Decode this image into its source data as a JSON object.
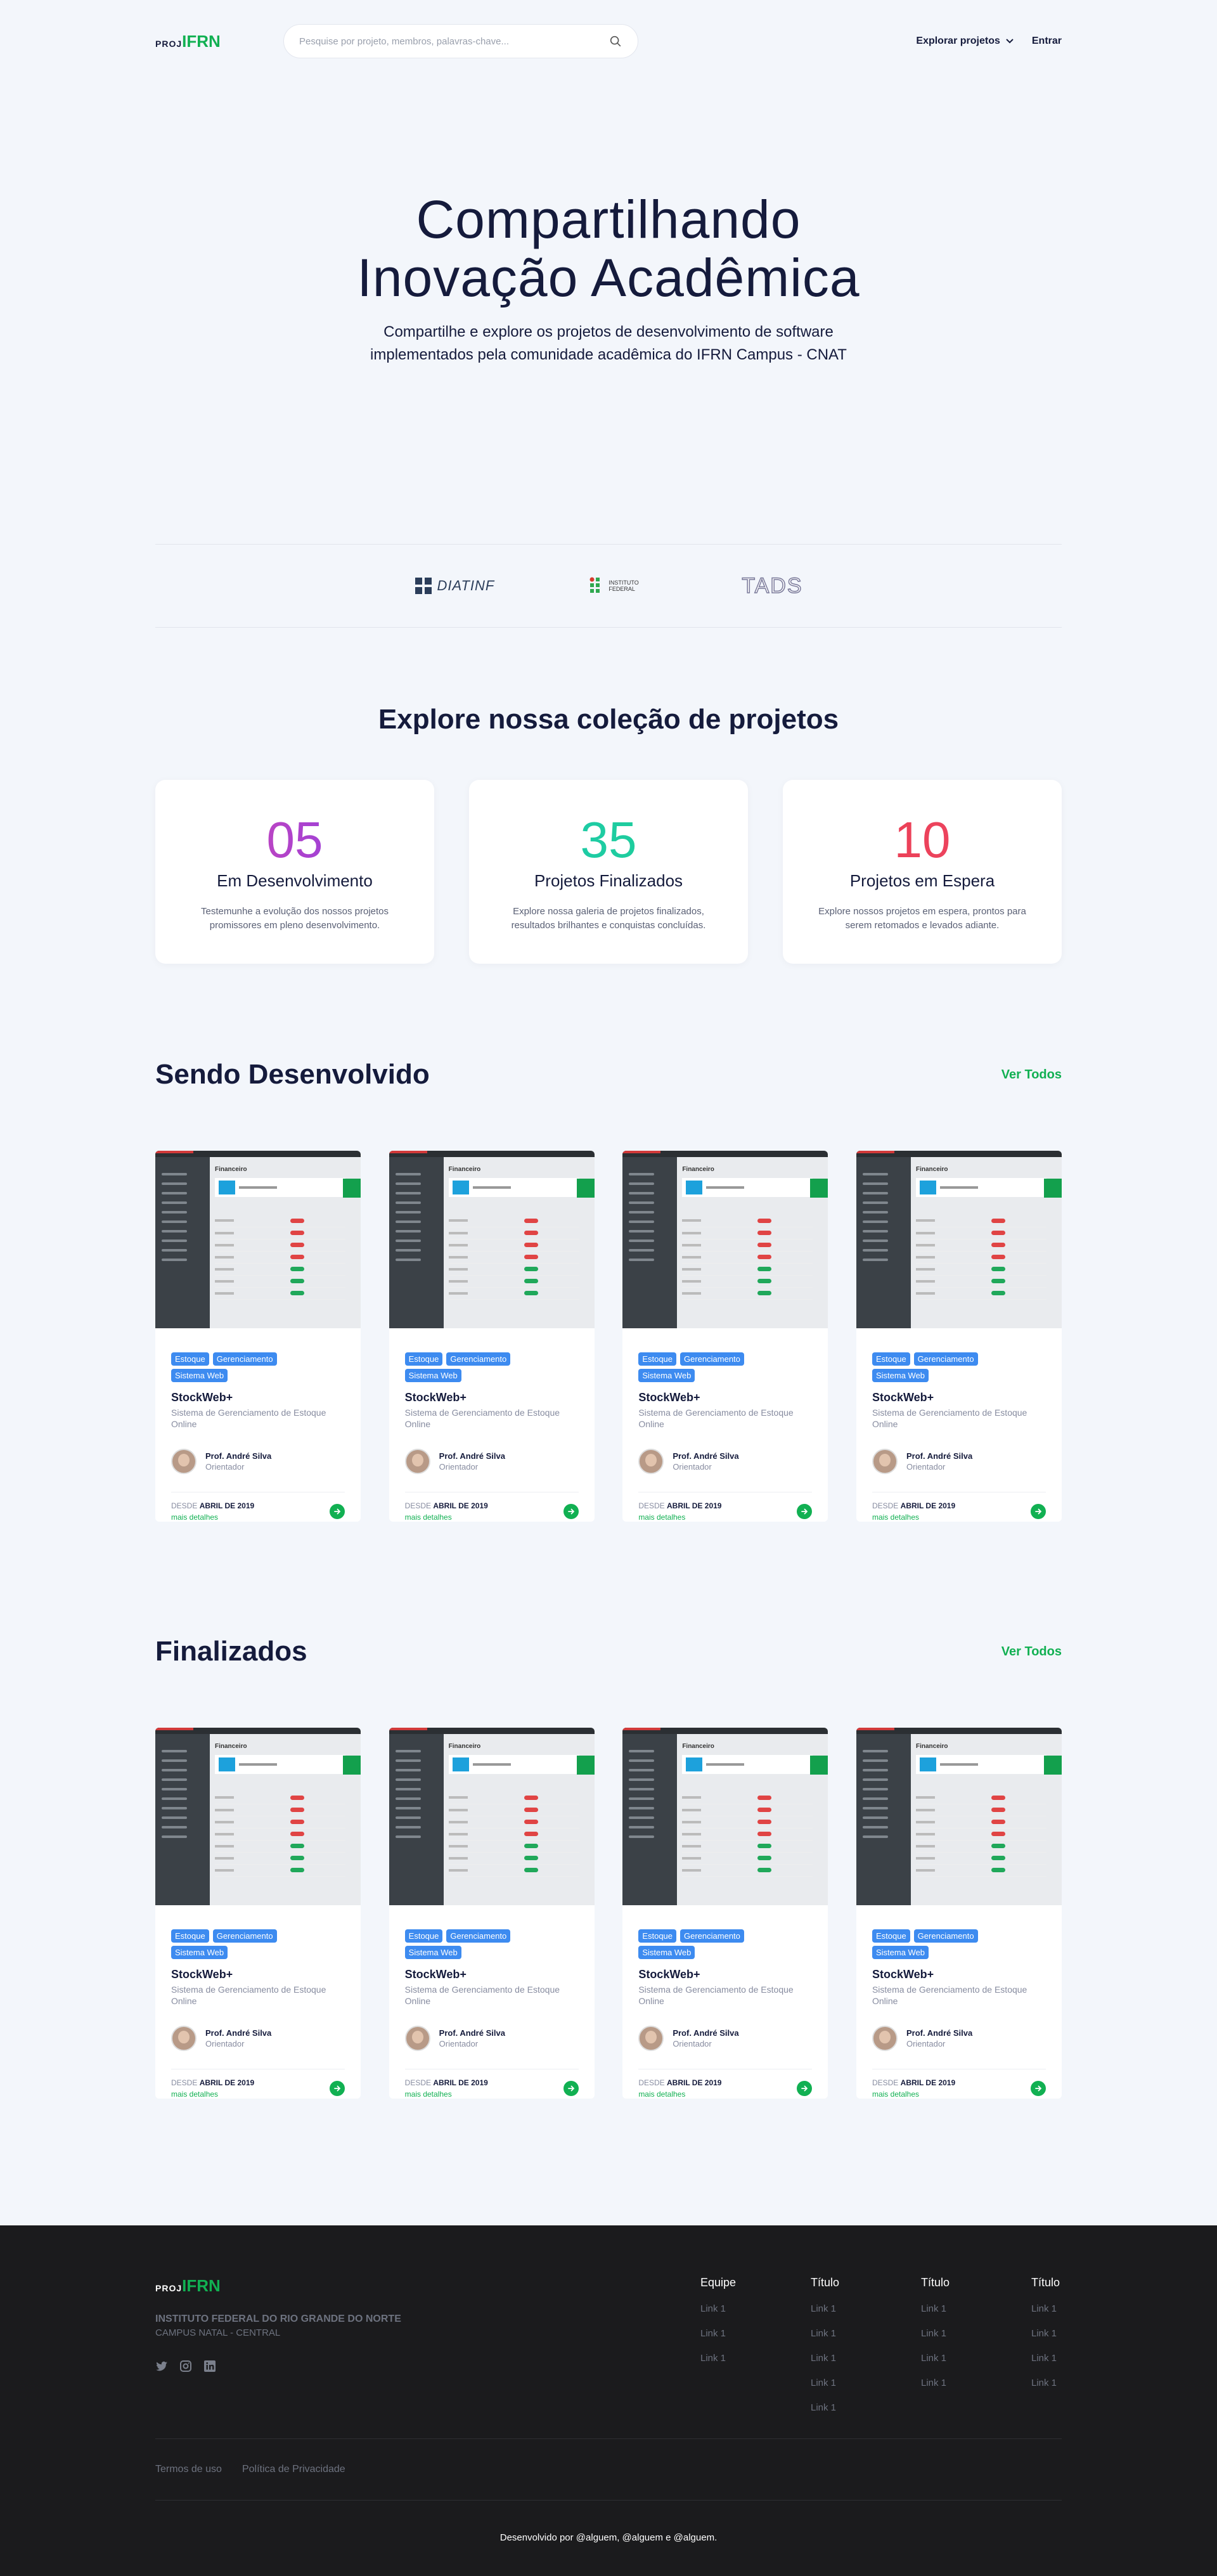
{
  "header": {
    "logo_prefix": "PROJ",
    "logo_brand": "IFRN",
    "search_placeholder": "Pesquise por projeto, membros, palavras-chave...",
    "explore_label": "Explorar projetos",
    "login_label": "Entrar"
  },
  "hero": {
    "title_line1": "Compartilhando",
    "title_line2": "Inovação Acadêmica",
    "subtitle_line1": "Compartilhe e explore os projetos de desenvolvimento de software",
    "subtitle_line2": "implementados pela comunidade acadêmica do IFRN Campus - CNAT"
  },
  "partners": [
    {
      "name": "DIATINF",
      "icon": "diatinf-logo"
    },
    {
      "name": "INSTITUTO FEDERAL",
      "icon": "if-logo"
    },
    {
      "name": "TADS",
      "icon": "tads-logo"
    }
  ],
  "explore": {
    "title": "Explore nossa coleção de projetos",
    "stats": [
      {
        "value": "05",
        "label": "Em Desenvolvimento",
        "desc": "Testemunhe a evolução dos nossos projetos promissores em pleno desenvolvimento.",
        "color_from": "#e34aa6",
        "color_to": "#7a3bf2"
      },
      {
        "value": "35",
        "label": "Projetos Finalizados",
        "desc": "Explore nossa galeria de projetos finalizados, resultados brilhantes e conquistas concluídas.",
        "color_from": "#1cc8b4",
        "color_to": "#20d08e"
      },
      {
        "value": "10",
        "label": "Projetos em Espera",
        "desc": "Explore nossos projetos em espera, prontos para serem retomados e levados adiante.",
        "color_from": "#e83a4a",
        "color_to": "#f04a6b"
      }
    ]
  },
  "sections": [
    {
      "title": "Sendo Desenvolvido",
      "link": "Ver Todos",
      "cards": [
        {
          "tags": [
            "Estoque",
            "Gerenciamento",
            "Sistema Web"
          ],
          "title": "StockWeb+",
          "desc": "Sistema de Gerenciamento de Estoque Online",
          "author": "Prof. André Silva",
          "role": "Orientador",
          "since_prefix": "DESDE",
          "since_date": "ABRIL DE 2019",
          "more": "mais detalhes",
          "shot_title": "Financeiro"
        },
        {
          "tags": [
            "Estoque",
            "Gerenciamento",
            "Sistema Web"
          ],
          "title": "StockWeb+",
          "desc": "Sistema de Gerenciamento de Estoque Online",
          "author": "Prof. André Silva",
          "role": "Orientador",
          "since_prefix": "DESDE",
          "since_date": "ABRIL DE 2019",
          "more": "mais detalhes",
          "shot_title": "Financeiro"
        },
        {
          "tags": [
            "Estoque",
            "Gerenciamento",
            "Sistema Web"
          ],
          "title": "StockWeb+",
          "desc": "Sistema de Gerenciamento de Estoque Online",
          "author": "Prof. André Silva",
          "role": "Orientador",
          "since_prefix": "DESDE",
          "since_date": "ABRIL DE 2019",
          "more": "mais detalhes",
          "shot_title": "Financeiro"
        },
        {
          "tags": [
            "Estoque",
            "Gerenciamento",
            "Sistema Web"
          ],
          "title": "StockWeb+",
          "desc": "Sistema de Gerenciamento de Estoque Online",
          "author": "Prof. André Silva",
          "role": "Orientador",
          "since_prefix": "DESDE",
          "since_date": "ABRIL DE 2019",
          "more": "mais detalhes",
          "shot_title": "Financeiro"
        }
      ]
    },
    {
      "title": "Finalizados",
      "link": "Ver Todos",
      "cards": [
        {
          "tags": [
            "Estoque",
            "Gerenciamento",
            "Sistema Web"
          ],
          "title": "StockWeb+",
          "desc": "Sistema de Gerenciamento de Estoque Online",
          "author": "Prof. André Silva",
          "role": "Orientador",
          "since_prefix": "DESDE",
          "since_date": "ABRIL DE 2019",
          "more": "mais detalhes",
          "shot_title": "Financeiro"
        },
        {
          "tags": [
            "Estoque",
            "Gerenciamento",
            "Sistema Web"
          ],
          "title": "StockWeb+",
          "desc": "Sistema de Gerenciamento de Estoque Online",
          "author": "Prof. André Silva",
          "role": "Orientador",
          "since_prefix": "DESDE",
          "since_date": "ABRIL DE 2019",
          "more": "mais detalhes",
          "shot_title": "Financeiro"
        },
        {
          "tags": [
            "Estoque",
            "Gerenciamento",
            "Sistema Web"
          ],
          "title": "StockWeb+",
          "desc": "Sistema de Gerenciamento de Estoque Online",
          "author": "Prof. André Silva",
          "role": "Orientador",
          "since_prefix": "DESDE",
          "since_date": "ABRIL DE 2019",
          "more": "mais detalhes",
          "shot_title": "Financeiro"
        },
        {
          "tags": [
            "Estoque",
            "Gerenciamento",
            "Sistema Web"
          ],
          "title": "StockWeb+",
          "desc": "Sistema de Gerenciamento de Estoque Online",
          "author": "Prof. André Silva",
          "role": "Orientador",
          "since_prefix": "DESDE",
          "since_date": "ABRIL DE 2019",
          "more": "mais detalhes",
          "shot_title": "Financeiro"
        }
      ]
    }
  ],
  "footer": {
    "logo_prefix": "PROJ",
    "logo_brand": "IFRN",
    "institution": "INSTITUTO FEDERAL DO RIO GRANDE DO NORTE",
    "campus": "CAMPUS NATAL - CENTRAL",
    "social": [
      "twitter-icon",
      "instagram-icon",
      "linkedin-icon"
    ],
    "columns": [
      {
        "title": "Equipe",
        "links": [
          "Link 1",
          "Link 1",
          "Link 1"
        ]
      },
      {
        "title": "Título",
        "links": [
          "Link 1",
          "Link 1",
          "Link 1",
          "Link 1",
          "Link 1"
        ]
      },
      {
        "title": "Título",
        "links": [
          "Link 1",
          "Link 1",
          "Link 1",
          "Link 1"
        ]
      },
      {
        "title": "Título",
        "links": [
          "Link 1",
          "Link 1",
          "Link 1",
          "Link 1"
        ]
      }
    ],
    "terms": "Termos de uso",
    "privacy": "Política de Privacidade",
    "credit": "Desenvolvido por @alguem, @alguem e @alguem."
  },
  "colors": {
    "accent": "#11b052",
    "tag": "#3d8bf0",
    "dark": "#151b3c",
    "footer_bg": "#1b1b1d"
  }
}
